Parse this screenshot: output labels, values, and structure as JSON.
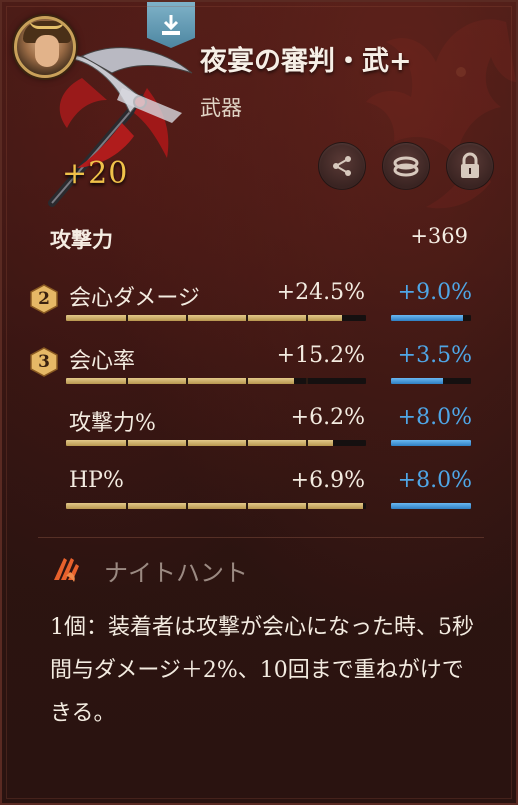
{
  "item": {
    "name": "夜宴の審判・武+",
    "type": "武器",
    "enhance_level": "+20"
  },
  "main_stat": {
    "label": "攻撃力",
    "value": "+369"
  },
  "sub_stats": [
    {
      "badge": "2",
      "label": "会心ダメージ",
      "value": "+24.5%",
      "bonus": "+9.0%",
      "fill": 0.92,
      "bonus_fill": 0.9
    },
    {
      "badge": "3",
      "label": "会心率",
      "value": "+15.2%",
      "bonus": "+3.5%",
      "fill": 0.76,
      "bonus_fill": 0.65
    },
    {
      "badge": "",
      "label": "攻撃力%",
      "value": "+6.2%",
      "bonus": "+8.0%",
      "fill": 0.89,
      "bonus_fill": 1.0
    },
    {
      "badge": "",
      "label": "HP%",
      "value": "+6.9%",
      "bonus": "+8.0%",
      "fill": 0.99,
      "bonus_fill": 1.0
    }
  ],
  "set_bonus": {
    "name": "ナイトハント",
    "description": "1個：装着者は攻撃が会心になった時、5秒間与ダメージ＋2%、10回まで重ねがけできる。"
  },
  "actions": {
    "share_icon": "share-icon",
    "compare_icon": "rings-icon",
    "lock_icon": "lock-icon",
    "download_icon": "download-icon"
  },
  "colors": {
    "enhance": "#f0c24a",
    "bonus": "#4fa6e6",
    "bar_fill": "#d4b874",
    "set_icon": "#e8612c"
  }
}
